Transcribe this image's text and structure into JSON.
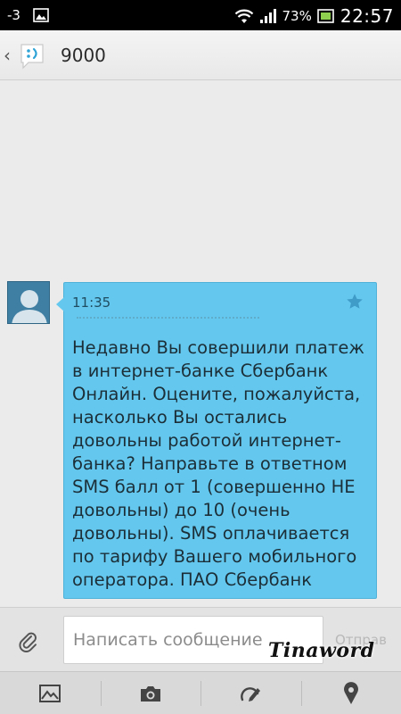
{
  "status_bar": {
    "signal_delta": "-3",
    "battery_percent": "73%",
    "time": "22:57"
  },
  "header": {
    "contact": "9000"
  },
  "message": {
    "time": "11:35",
    "text": "Недавно Вы совершили платеж в интернет-банке Сбербанк Онлайн. Оцените, пожалуйста, насколько Вы остались довольны работой интернет-банка? Направьте в ответном SMS балл от 1 (совершенно НЕ довольны) до 10 (очень довольны). SMS оплачивается по тарифу Вашего мобильного оператора. ПАО Сбербанк"
  },
  "compose": {
    "placeholder": "Написать сообщение",
    "send_label": "Отправ"
  },
  "watermark": "Tinaword",
  "colors": {
    "bubble": "#64c8ee",
    "avatar": "#3f7fa3",
    "status_bar": "#000000"
  },
  "icons": {
    "toolbar": [
      "gallery-icon",
      "camera-icon",
      "sketch-icon",
      "location-icon"
    ]
  }
}
